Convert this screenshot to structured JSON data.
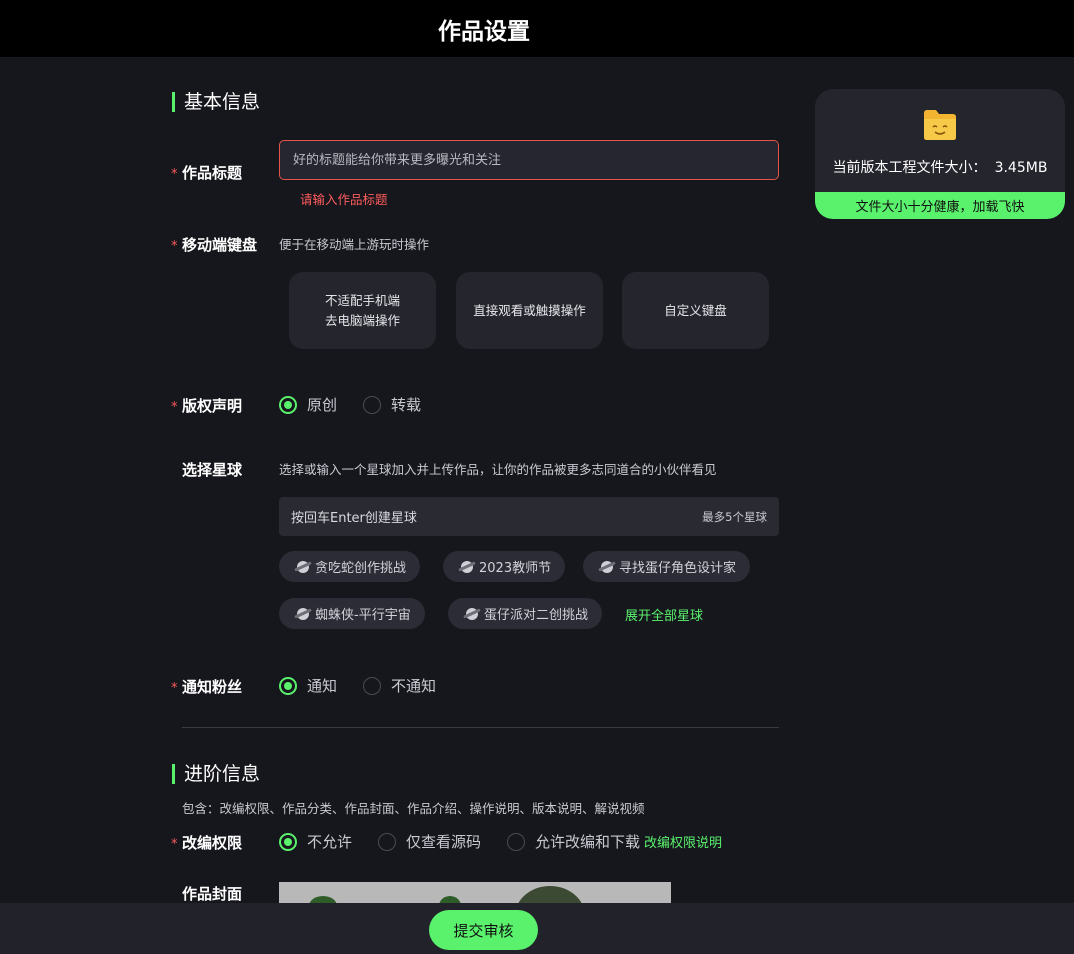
{
  "header": {
    "title": "作品设置"
  },
  "basic": {
    "section_title": "基本信息",
    "title_field": {
      "label": "作品标题",
      "required": "*",
      "placeholder": "好的标题能给你带来更多曝光和关注",
      "value": "",
      "error": "请输入作品标题"
    },
    "keyboard": {
      "label": "移动端键盘",
      "required": "*",
      "hint": "便于在移动端上游玩时操作",
      "options": [
        {
          "line1": "不适配手机端",
          "line2": "去电脑端操作"
        },
        {
          "line1": "直接观看或触摸操作"
        },
        {
          "line1": "自定义键盘"
        }
      ]
    },
    "copyright": {
      "label": "版权声明",
      "required": "*",
      "options": [
        "原创",
        "转载"
      ],
      "selected": "原创"
    },
    "planet": {
      "label": "选择星球",
      "hint": "选择或输入一个星球加入并上传作品，让你的作品被更多志同道合的小伙伴看见",
      "input_placeholder": "按回车Enter创建星球",
      "max_hint": "最多5个星球",
      "tags": [
        "贪吃蛇创作挑战",
        "2023教师节",
        "寻找蛋仔角色设计家",
        "蜘蛛侠-平行宇宙",
        "蛋仔派对二创挑战"
      ],
      "expand_label": "展开全部星球"
    },
    "notify": {
      "label": "通知粉丝",
      "required": "*",
      "options": [
        "通知",
        "不通知"
      ],
      "selected": "通知"
    }
  },
  "advanced": {
    "section_title": "进阶信息",
    "description": "包含：改编权限、作品分类、作品封面、作品介绍、操作说明、版本说明、解说视频",
    "permission": {
      "label": "改编权限",
      "required": "*",
      "options": [
        "不允许",
        "仅查看源码",
        "允许改编和下载"
      ],
      "selected": "不允许",
      "help_link": "改编权限说明"
    },
    "cover": {
      "label": "作品封面"
    }
  },
  "file_card": {
    "size_label": "当前版本工程文件大小：",
    "size_value": "3.45MB",
    "health": "文件大小十分健康，加载飞快"
  },
  "footer": {
    "submit_label": "提交审核"
  },
  "colors": {
    "accent": "#5af26d",
    "error": "#e5534b",
    "background": "#16161d"
  }
}
